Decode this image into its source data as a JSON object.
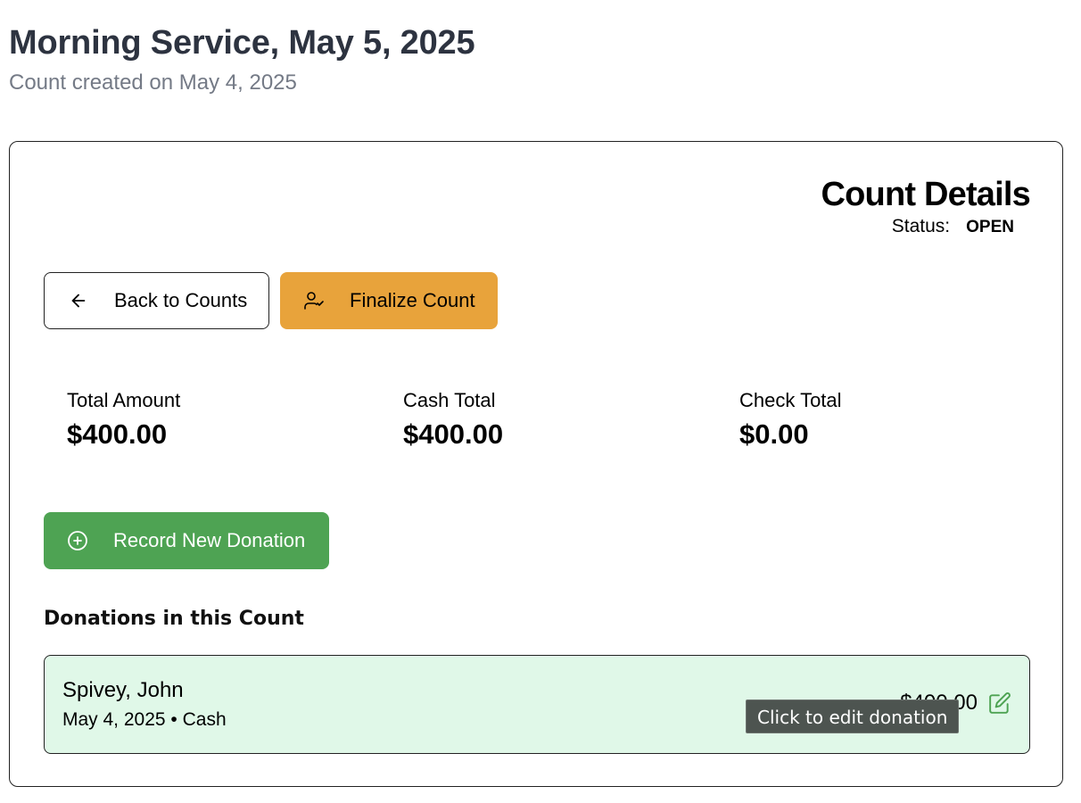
{
  "page": {
    "title": "Morning Service, May 5, 2025",
    "subtitle": "Count created on May 4, 2025"
  },
  "details": {
    "title": "Count Details",
    "status_label": "Status:",
    "status_value": "OPEN"
  },
  "actions": {
    "back_label": "Back to Counts",
    "back_icon": "arrow-left-icon",
    "finalize_label": "Finalize Count",
    "finalize_icon": "user-check-icon",
    "finalize_color": "#e8a33b",
    "record_label": "Record New Donation",
    "record_icon": "plus-circle-icon",
    "record_color": "#4ea353"
  },
  "stats": [
    {
      "label": "Total Amount",
      "value": "$400.00"
    },
    {
      "label": "Cash Total",
      "value": "$400.00"
    },
    {
      "label": "Check Total",
      "value": "$0.00"
    }
  ],
  "donations": {
    "title": "Donations in this Count",
    "items": [
      {
        "name": "Spivey, John",
        "meta": "May 4, 2025 • Cash",
        "amount": "$400.00",
        "row_color": "#e0f8e8",
        "edit_icon": "edit-icon"
      }
    ]
  },
  "tooltip": {
    "text": "Click to edit donation"
  }
}
